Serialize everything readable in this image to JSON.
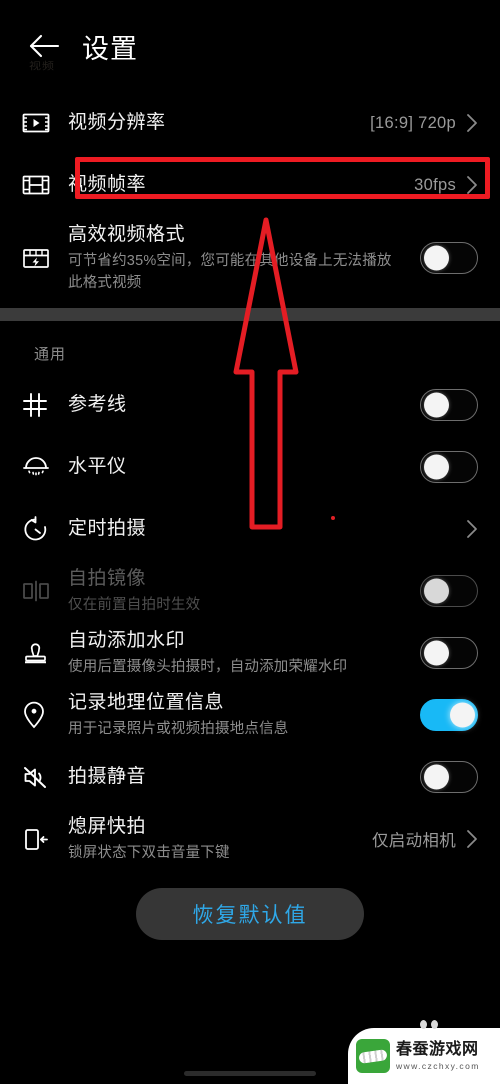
{
  "header": {
    "title": "设置",
    "back_icon": "arrow-left-icon",
    "ghost_label": "视频"
  },
  "video_section": {
    "rows": [
      {
        "icon": "film-play-icon",
        "title": "视频分辨率",
        "value": "[16:9] 720p",
        "chevron": true
      },
      {
        "icon": "film-frames-icon",
        "title": "视频帧率",
        "value": "30fps",
        "chevron": true,
        "highlighted": true
      },
      {
        "icon": "film-bolt-icon",
        "title": "高效视频格式",
        "sub": "可节省约35%空间，您可能在其他设备上无法播放此格式视频",
        "toggle": "off"
      }
    ]
  },
  "general_section": {
    "label": "通用",
    "rows": [
      {
        "icon": "grid-lines-icon",
        "title": "参考线",
        "toggle": "off"
      },
      {
        "icon": "level-meter-icon",
        "title": "水平仪",
        "toggle": "off"
      },
      {
        "icon": "timer-icon",
        "title": "定时拍摄",
        "chevron": true
      },
      {
        "icon": "mirror-icon",
        "title": "自拍镜像",
        "sub": "仅在前置自拍时生效",
        "toggle": "off",
        "disabled": true
      },
      {
        "icon": "stamp-icon",
        "title": "自动添加水印",
        "sub": "使用后置摄像头拍摄时，自动添加荣耀水印",
        "toggle": "off"
      },
      {
        "icon": "location-pin-icon",
        "title": "记录地理位置信息",
        "sub": "用于记录照片或视频拍摄地点信息",
        "toggle": "on"
      },
      {
        "icon": "mute-speaker-icon",
        "title": "拍摄静音",
        "toggle": "off"
      },
      {
        "icon": "phone-quickshot-icon",
        "title": "熄屏快拍",
        "sub": "锁屏状态下双击音量下键",
        "value": "仅启动相机",
        "chevron": true
      }
    ]
  },
  "footer": {
    "restore_label": "恢复默认值"
  },
  "annotations": {
    "highlight_color": "#ee1b22",
    "arrow_color": "#e41d24",
    "arrow_name": "red-up-arrow"
  },
  "watermark": {
    "title": "春蚕游戏网",
    "url": "www.czchxy.com"
  },
  "colors": {
    "accent_on": "#18b9f6",
    "restore_text": "#2fa8e8",
    "background": "#000000"
  }
}
